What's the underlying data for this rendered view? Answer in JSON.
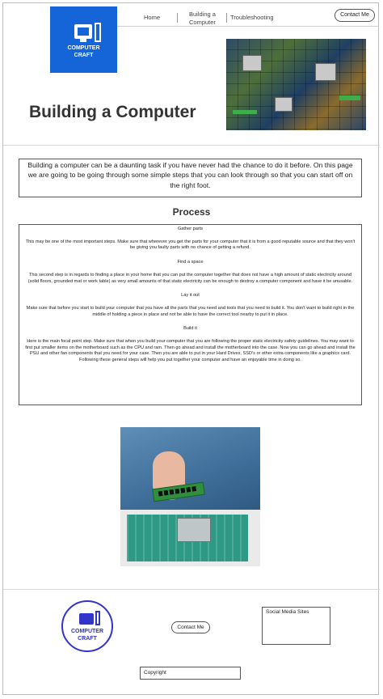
{
  "header": {
    "logo_text_line1": "COMPUTER",
    "logo_text_line2": "CRAFT",
    "nav": {
      "home": "Home",
      "building_line1": "Building a",
      "building_line2": "Computer",
      "troubleshooting": "Troubleshooting"
    },
    "contact_label": "Contact Me"
  },
  "hero": {
    "title": "Building a Computer"
  },
  "intro": {
    "text": "Building a computer can be a daunting task if you have never had the chance to do it before. On this page we are going to be going through some simple steps that you can look through so that you can start off on the right foot."
  },
  "process": {
    "heading": "Process",
    "steps": [
      {
        "title": "Gather parts",
        "body": "This may be one of the most important steps. Make sure that wherever you get the parts for your computer that it is from a good reputable source and that they won't be giving you faulty parts with no chance of getting a refund."
      },
      {
        "title": "Find a space",
        "body": "This second step is in regards to finding a place in your home that you can put the computer together that does not have a high amount of static electricity around (solid floors, grounded mat or work table) as very small amounts of that static electricity can be enough to destroy a computer component and have it be unusable."
      },
      {
        "title": "Lay it out",
        "body": "Make sure that before you start to build your computer that you have all the parts that you need and tools that you need to build it. You don't want to build right in the middle of holding a piece in place and not be able to have the correct tool nearby to put it in place."
      },
      {
        "title": "Build it",
        "body": "Here is the main focal point step. Make sure that when you build your computer that you are following the proper static electricity safety guidelines. You may want to first put smaller items on the motherboard such as the CPU and ram. Then go ahead and install the motherboard into the case. Now you can go ahead and install the PSU and other fan components that you need for your case. Then you are able to put in your Hard Drives, SSD's or other extra components like a graphics card. Following these general steps will help you put together your computer and have an enjoyable time in doing so."
      }
    ]
  },
  "footer": {
    "logo_text_line1": "COMPUTER",
    "logo_text_line2": "CRAFT",
    "contact_label": "Contact Me",
    "social_label": "Social Media Sites",
    "copyright_label": "Copyright"
  }
}
